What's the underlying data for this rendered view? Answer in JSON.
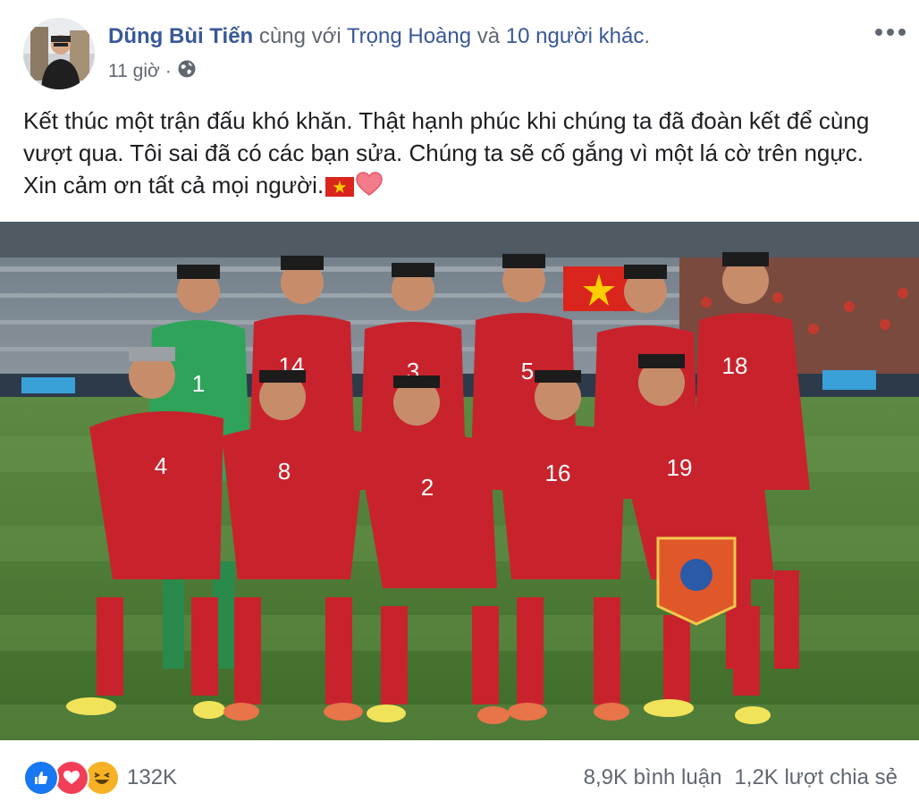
{
  "post": {
    "author": "Dũng Bùi Tiến",
    "with_text": " cùng với ",
    "tagged_person": "Trọng Hoàng",
    "and_text": " và ",
    "others_link": "10 người khác",
    "period": ".",
    "time": "11 giờ",
    "separator": "·",
    "privacy_icon": "globe-icon",
    "more_icon": "more-horizontal-icon",
    "body_text": "Kết thúc một trận đấu khó khăn. Thật hạnh phúc khi chúng ta đã đoàn kết để cùng vượt qua. Tôi sai đã có các bạn sửa. Chúng ta sẽ cố gắng vì một lá cờ trên ngực. Xin cảm ơn tất cả mọi người."
  },
  "photo": {
    "jersey_numbers_back_row": [
      "1",
      "14",
      "3",
      "5",
      "18"
    ],
    "jersey_numbers_front_row": [
      "4",
      "8",
      "2",
      "16",
      "19"
    ]
  },
  "footer": {
    "reaction_icons": [
      "like-icon",
      "love-icon",
      "haha-icon"
    ],
    "reaction_count": "132K",
    "comments": "8,9K bình luận",
    "shares": "1,2K lượt chia sẻ"
  },
  "colors": {
    "link": "#385898",
    "secondary_text": "#606770",
    "jersey_red": "#c8232c",
    "pitch_green": "#4a7a33",
    "like_blue": "#1877f2",
    "love_red": "#f33e58",
    "haha_yellow": "#f7b125"
  }
}
